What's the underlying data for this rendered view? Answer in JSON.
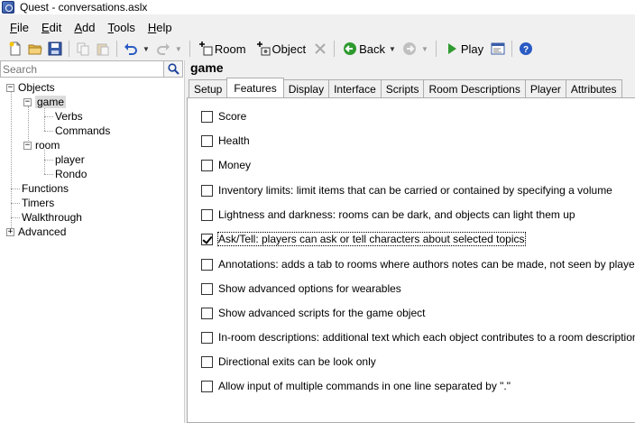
{
  "window": {
    "title": "Quest - conversations.aslx"
  },
  "menu": [
    {
      "prefix": "",
      "ul": "F",
      "rest": "ile"
    },
    {
      "prefix": "",
      "ul": "E",
      "rest": "dit"
    },
    {
      "prefix": "",
      "ul": "A",
      "rest": "dd"
    },
    {
      "prefix": "",
      "ul": "T",
      "rest": "ools"
    },
    {
      "prefix": "",
      "ul": "H",
      "rest": "elp"
    }
  ],
  "toolbar": {
    "room_label": "Room",
    "object_label": "Object",
    "back_label": "Back",
    "play_label": "Play"
  },
  "search": {
    "placeholder": "Search"
  },
  "tree": {
    "objects": "Objects",
    "game": "game",
    "verbs": "Verbs",
    "commands": "Commands",
    "room": "room",
    "player": "player",
    "rondo": "Rondo",
    "functions": "Functions",
    "timers": "Timers",
    "walkthrough": "Walkthrough",
    "advanced": "Advanced"
  },
  "main": {
    "title": "game",
    "tabs": [
      "Setup",
      "Features",
      "Display",
      "Interface",
      "Scripts",
      "Room Descriptions",
      "Player",
      "Attributes"
    ],
    "active_tab": "Features"
  },
  "features": [
    {
      "label": "Score",
      "checked": false
    },
    {
      "label": "Health",
      "checked": false
    },
    {
      "label": "Money",
      "checked": false
    },
    {
      "label": "Inventory limits: limit items that can be carried or contained by specifying a volume",
      "checked": false
    },
    {
      "label": "Lightness and darkness: rooms can be dark, and objects can light them up",
      "checked": false
    },
    {
      "label": "Ask/Tell: players can ask or tell characters about selected topics",
      "checked": true
    },
    {
      "label": "Annotations: adds a tab to rooms where authors notes can be made, not seen by players",
      "checked": false
    },
    {
      "label": "Show advanced options for wearables",
      "checked": false
    },
    {
      "label": "Show advanced scripts for the game object",
      "checked": false
    },
    {
      "label": "In-room descriptions: additional text which each object contributes to a room description",
      "checked": false
    },
    {
      "label": "Directional exits can be look only",
      "checked": false
    },
    {
      "label": "Allow input of multiple commands in one line separated by \".\"",
      "checked": false
    }
  ],
  "colors": {
    "selection": "#dcdcdc",
    "panel_bg": "#ffffff",
    "chrome_bg": "#f0f0f0",
    "play_green": "#2f9a2f",
    "back_green": "#2f9a2f",
    "help_blue": "#2a5bc4"
  }
}
